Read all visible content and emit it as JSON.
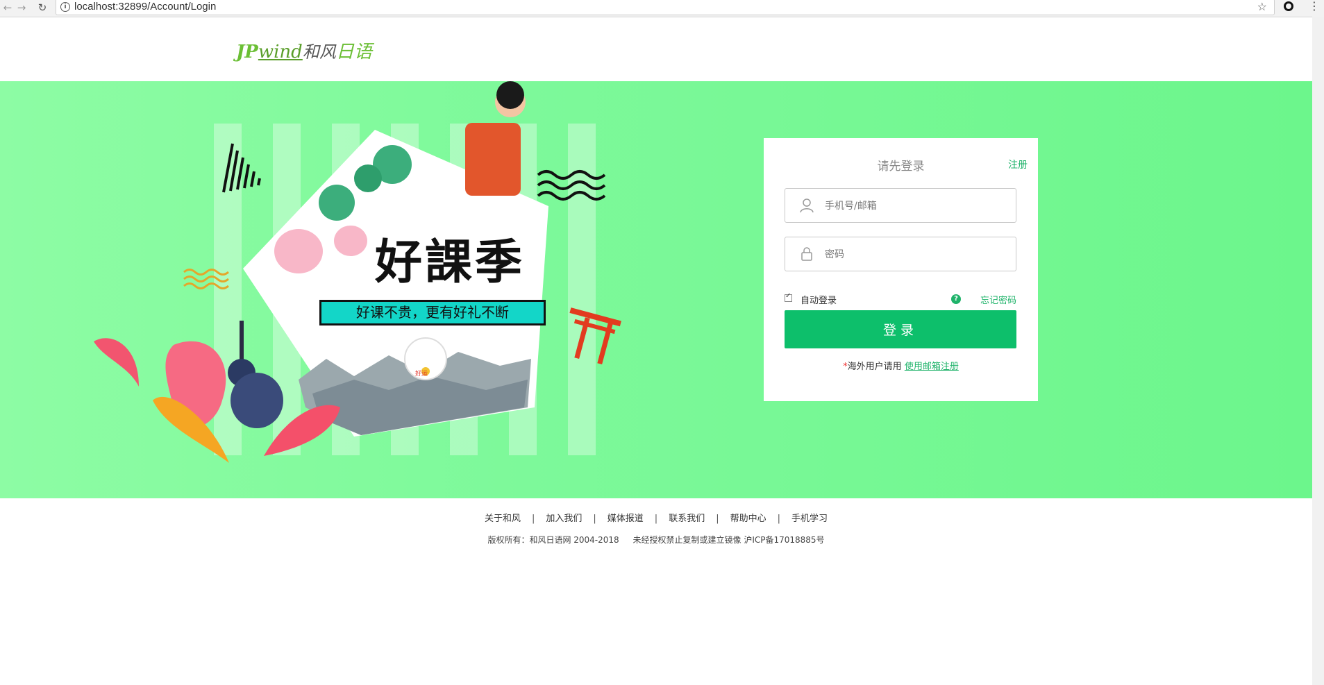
{
  "browser": {
    "url": "localhost:32899/Account/Login"
  },
  "header": {
    "logo_jp": "JP",
    "logo_wind": "wind",
    "logo_cn": "和风",
    "logo_tail": "日语"
  },
  "banner": {
    "headline": "好課季",
    "tagline": "好课不贵，更有好礼不断",
    "cat_text": "好运"
  },
  "login": {
    "title": "请先登录",
    "register_label": "注册",
    "username_placeholder": "手机号/邮箱",
    "password_placeholder": "密码",
    "auto_login_label": "自动登录",
    "auto_login_checked": true,
    "forgot_label": "忘记密码",
    "submit_label": "登录",
    "overseas_prefix": "*",
    "overseas_text": "海外用户请用",
    "overseas_link": "使用邮箱注册"
  },
  "footer": {
    "links": [
      "关于和风",
      "加入我们",
      "媒体报道",
      "联系我们",
      "帮助中心",
      "手机学习"
    ],
    "copyright": "版权所有：和风日语网 2004-2018",
    "notice": "未经授权禁止复制或建立镜像 沪ICP备17018885号"
  },
  "colors": {
    "accent": "#0dbf6b",
    "banner": "#7df99a"
  }
}
